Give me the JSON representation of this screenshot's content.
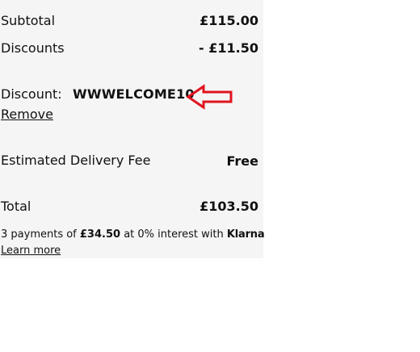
{
  "summary": {
    "subtotal_label": "Subtotal",
    "subtotal_value": "£115.00",
    "discounts_label": "Discounts",
    "discounts_value": "- £11.50",
    "discount_label": "Discount:",
    "discount_code": "WWWELCOME10",
    "remove_link": "Remove",
    "delivery_label": "Estimated Delivery Fee",
    "delivery_value": "Free",
    "total_label": "Total",
    "total_value": "£103.50"
  },
  "klarna": {
    "prefix": "3 payments of ",
    "amount": "£34.50",
    "suffix": " at 0% interest with ",
    "brand": "Klarna",
    "learn_more": "Learn more"
  },
  "annotation": {
    "arrow_color": "#e0141e"
  }
}
